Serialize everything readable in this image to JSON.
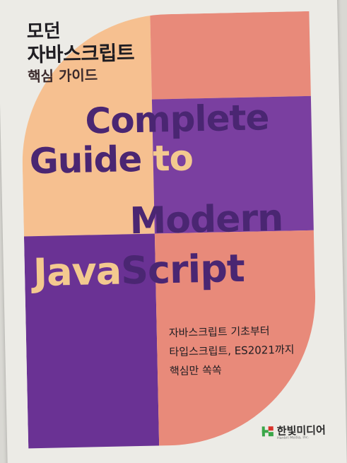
{
  "cover": {
    "title_kr_line1": "모던",
    "title_kr_line2": "자바스크립트",
    "title_kr_line3": "핵심 가이드",
    "credits": [
      "",
      ""
    ],
    "title_en": {
      "line1": "Complete",
      "line2_a": "Guide ",
      "line2_b": "to",
      "line3": "Modern",
      "line4_a": "Java",
      "line4_b": "Script"
    },
    "subtitle": [
      "자바스크립트 기초부터",
      "타입스크립트, ES2021까지",
      "핵심만 쏙쏙"
    ],
    "publisher": {
      "name": "한빛미디어",
      "name_en": "Hanbit Media, Inc.",
      "logo_icon": "hanbit-logo-icon"
    },
    "colors": {
      "cover_bg": "#ecebe6",
      "peach": "#f6c090",
      "coral": "#e88a7a",
      "purple": "#7a3fa0",
      "violet": "#5d2c86",
      "title_purple": "#4a2672",
      "title_peach": "#f3c98f",
      "publisher_green": "#3aa648",
      "publisher_red": "#d8332a"
    }
  }
}
